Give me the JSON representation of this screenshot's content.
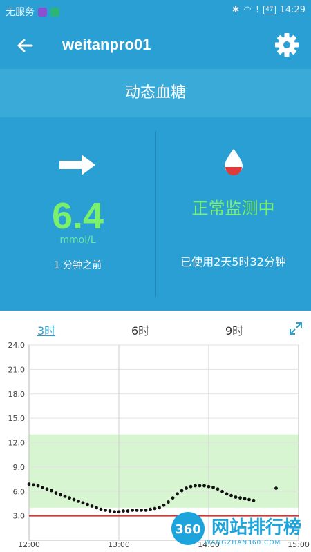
{
  "status_bar": {
    "carrier": "无服务",
    "time": "14:29",
    "battery": "47"
  },
  "header": {
    "title": "weitanpro01"
  },
  "section": {
    "title": "动态血糖"
  },
  "reading": {
    "value": "6.4",
    "unit": "mmol/L",
    "time_ago": "1 分钟之前",
    "trend_icon": "arrow-right-icon"
  },
  "monitor": {
    "status": "正常监测中",
    "elapsed": "已使用2天5时32分钟"
  },
  "tabs": [
    {
      "label": "3时",
      "active": true
    },
    {
      "label": "6时",
      "active": false
    },
    {
      "label": "9时",
      "active": false
    }
  ],
  "watermark": {
    "text": "网站排行榜",
    "sub": "WANGZHAN360.COM",
    "logo": "360"
  },
  "colors": {
    "primary": "#2a9fd3",
    "glucose_green": "#7bf06a",
    "target_band": "#d8f5d2",
    "low_line": "#e03030"
  },
  "chart_data": {
    "type": "scatter",
    "title": "",
    "xlabel": "",
    "ylabel": "",
    "ylim": [
      0,
      24
    ],
    "yticks": [
      "3.0",
      "6.0",
      "9.0",
      "12.0",
      "15.0",
      "18.0",
      "21.0",
      "24.0"
    ],
    "xticks": [
      "12:00",
      "13:00",
      "14:00",
      "15:00"
    ],
    "xlim_minutes": [
      0,
      180
    ],
    "target_range": [
      4.0,
      13.0
    ],
    "low_threshold": 3.0,
    "series": [
      {
        "x": [
          0,
          3,
          6,
          9,
          12,
          15,
          18,
          21,
          24,
          27,
          30,
          33,
          36,
          39,
          42,
          45,
          48,
          51,
          54,
          57,
          60,
          63,
          66,
          69,
          72,
          75,
          78,
          81,
          84,
          87,
          90,
          93,
          96,
          99,
          102,
          105,
          108,
          111,
          114,
          117,
          120,
          123,
          126,
          129,
          132,
          135,
          138,
          141,
          144,
          147,
          150,
          165
        ],
        "y": [
          6.9,
          6.8,
          6.7,
          6.5,
          6.3,
          6.1,
          5.8,
          5.6,
          5.4,
          5.2,
          5.0,
          4.8,
          4.6,
          4.4,
          4.2,
          4.0,
          3.8,
          3.7,
          3.6,
          3.5,
          3.5,
          3.6,
          3.6,
          3.7,
          3.7,
          3.7,
          3.7,
          3.8,
          3.9,
          4.0,
          4.3,
          4.7,
          5.2,
          5.7,
          6.1,
          6.4,
          6.6,
          6.7,
          6.7,
          6.7,
          6.6,
          6.5,
          6.3,
          6.0,
          5.7,
          5.5,
          5.3,
          5.2,
          5.1,
          5.0,
          4.9,
          6.4
        ]
      }
    ]
  }
}
